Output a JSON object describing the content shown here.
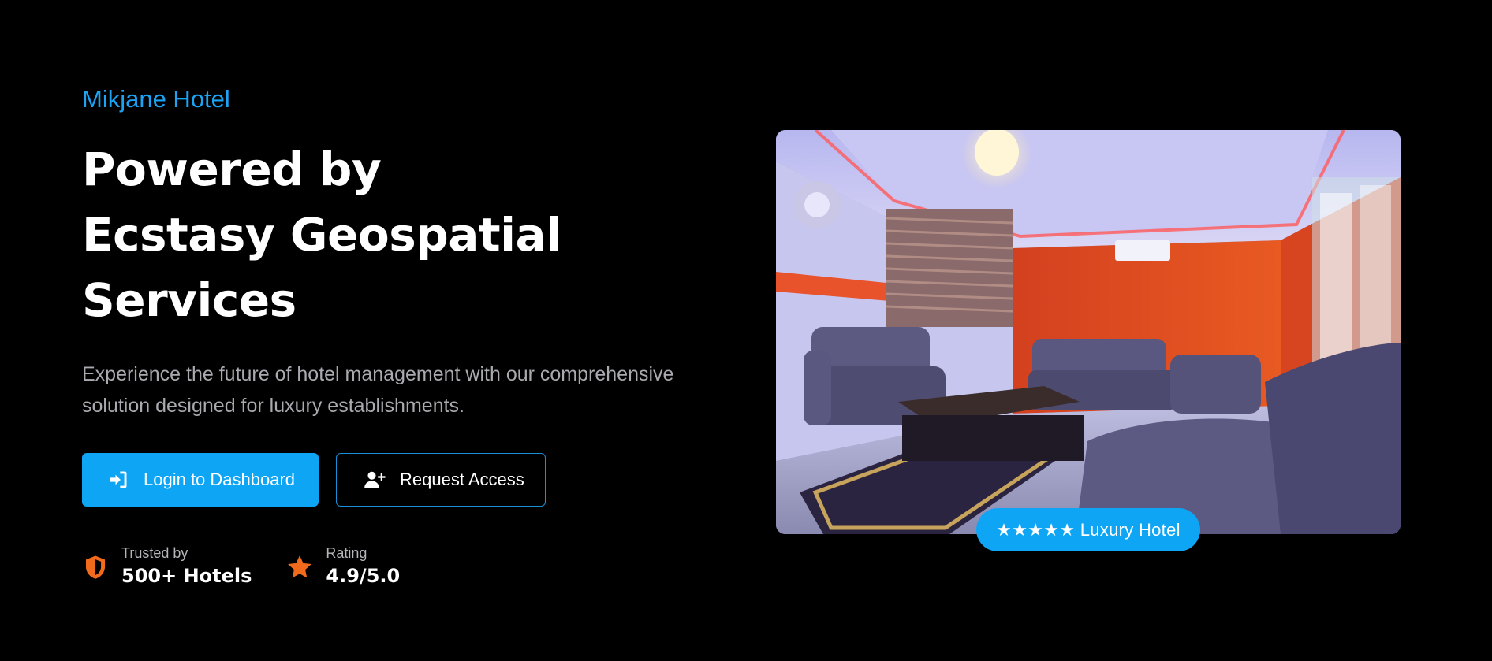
{
  "hero": {
    "brand": "Mikjane Hotel",
    "headline_lines": [
      "Powered by",
      "Ecstasy Geospatial",
      "Services"
    ],
    "description_lines": [
      "Experience the future of hotel management with our comprehensive",
      "solution designed for luxury establishments."
    ]
  },
  "buttons": {
    "login": {
      "label": "Login to Dashboard",
      "icon": "login-icon"
    },
    "request": {
      "label": "Request Access",
      "icon": "user-plus-icon"
    }
  },
  "stats": [
    {
      "label": "Trusted by",
      "value": "500+ Hotels",
      "icon": "shield-icon"
    },
    {
      "label": "Rating",
      "value": "4.9/5.0",
      "icon": "star-icon"
    }
  ],
  "image": {
    "subject": "hotel lounge photo",
    "badge": "★★★★★ Luxury Hotel"
  },
  "colors": {
    "background": "#000000",
    "accent": "#0ea5f5",
    "brand_text": "#1ca3f4",
    "icon_orange": "#f26a1b",
    "muted_text": "#a9a9b0"
  }
}
